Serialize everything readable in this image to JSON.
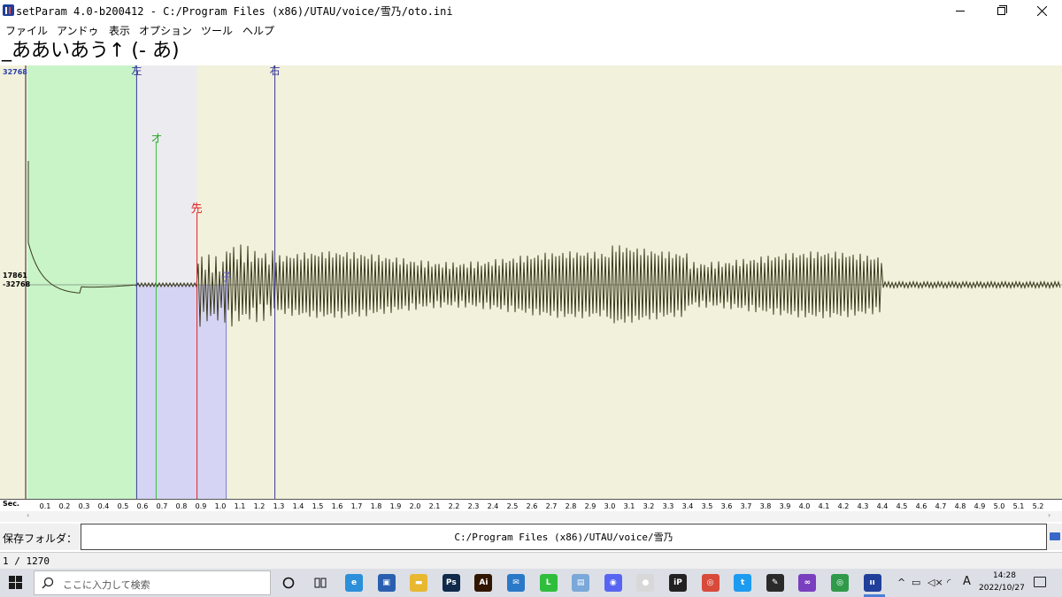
{
  "window": {
    "title": "setParam 4.0-b200412 -  C:/Program Files (x86)/UTAU/voice/雪乃/oto.ini"
  },
  "menu": {
    "items": [
      "ファイル",
      "アンドゥ",
      "表示",
      "オプション",
      "ツール",
      "ヘルプ"
    ]
  },
  "editor": {
    "alias": "_ああいあう↑ (- あ)",
    "amplitude_labels": {
      "top": "32768",
      "mid_positive": "17861",
      "mid_negative": "-32768"
    },
    "markers": {
      "left": "左",
      "right": "右",
      "overlap": "オ",
      "preutterance": "先",
      "consonant": "子"
    },
    "marker_times_sec": {
      "left": 0.57,
      "overlap": 0.67,
      "preutterance": 0.88,
      "consonant": 1.03,
      "right": 1.28
    },
    "time_axis": {
      "label": "Sec.",
      "ticks": [
        "0.1",
        "0.2",
        "0.3",
        "0.4",
        "0.5",
        "0.6",
        "0.7",
        "0.8",
        "0.9",
        "1.0",
        "1.1",
        "1.2",
        "1.3",
        "1.4",
        "1.5",
        "1.6",
        "1.7",
        "1.8",
        "1.9",
        "2.0",
        "2.1",
        "2.2",
        "2.3",
        "2.4",
        "2.5",
        "2.6",
        "2.7",
        "2.8",
        "2.9",
        "3.0",
        "3.1",
        "3.2",
        "3.3",
        "3.4",
        "3.5",
        "3.6",
        "3.7",
        "3.8",
        "3.9",
        "4.0",
        "4.1",
        "4.2",
        "4.3",
        "4.4",
        "4.5",
        "4.6",
        "4.7",
        "4.8",
        "4.9",
        "5.0",
        "5.1",
        "5.2"
      ]
    },
    "colors": {
      "offset_region": "#c8f4c8",
      "overlap_region": "#d6d4f4",
      "consonant_region": "#d0d0f0",
      "right_blank": "#f2f1dc",
      "overlap_line": "#36c036",
      "preutterance_line": "#e02020",
      "boundary_line": "#3a3a9a",
      "waveform": "#3b3b1e"
    }
  },
  "save_folder": {
    "label": "保存フォルダ：",
    "path": "C:/Program Files (x86)/UTAU/voice/雪乃"
  },
  "status": {
    "text": "1 / 1270"
  },
  "taskbar": {
    "search_placeholder": "ここに入力して検索",
    "apps": [
      {
        "name": "edge-icon",
        "color": "#2b8fd9",
        "glyph": "e"
      },
      {
        "name": "store-icon",
        "color": "#2a5fb0",
        "glyph": "▣"
      },
      {
        "name": "explorer-icon",
        "color": "#e8b830",
        "glyph": "▬"
      },
      {
        "name": "photoshop-icon",
        "color": "#0f2a4a",
        "glyph": "Ps"
      },
      {
        "name": "illustrator-icon",
        "color": "#321500",
        "glyph": "Ai"
      },
      {
        "name": "mail-icon",
        "color": "#2a78c8",
        "glyph": "✉"
      },
      {
        "name": "line-icon",
        "color": "#2fbe3c",
        "glyph": "L"
      },
      {
        "name": "notepad-icon",
        "color": "#7aa8d8",
        "glyph": "▤"
      },
      {
        "name": "discord-icon",
        "color": "#5865f2",
        "glyph": "◉"
      },
      {
        "name": "palette-icon",
        "color": "#d8d8d8",
        "glyph": "●"
      },
      {
        "name": "clip-studio-icon",
        "color": "#222222",
        "glyph": "iP"
      },
      {
        "name": "chrome-icon",
        "color": "#d84a3a",
        "glyph": "◎"
      },
      {
        "name": "twitter-icon",
        "color": "#1d9bf0",
        "glyph": "t"
      },
      {
        "name": "sticky-icon",
        "color": "#2a2a2a",
        "glyph": "✎"
      },
      {
        "name": "visual-studio-icon",
        "color": "#7a3fbf",
        "glyph": "∞"
      },
      {
        "name": "chrome-alt-icon",
        "color": "#2f9a4a",
        "glyph": "◎"
      },
      {
        "name": "setparam-icon",
        "color": "#1f3f9a",
        "glyph": "ıı"
      }
    ],
    "ime": "A",
    "clock_time": "14:28",
    "clock_date": "2022/10/27"
  }
}
